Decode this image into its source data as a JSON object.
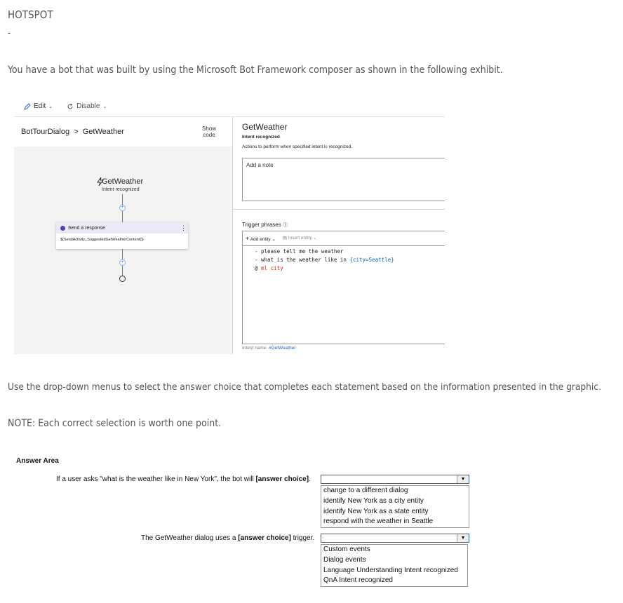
{
  "question": {
    "title": "HOTSPOT",
    "dash": "-",
    "intro": "You have a bot that was built by using the Microsoft Bot Framework composer as shown in the following exhibit.",
    "instruction": "Use the drop-down menus to select the answer choice that completes each statement based on the information presented in the graphic.",
    "note": "NOTE: Each correct selection is worth one point."
  },
  "exhibit": {
    "toolbar": {
      "edit": "Edit",
      "disable": "Disable"
    },
    "breadcrumb": "BotTourDialog  >  GetWeather",
    "show_code": [
      "Show",
      "code"
    ],
    "flow": {
      "trigger_title": "GetWeather",
      "trigger_sub": "Intent recognized",
      "card_title": "Send a response",
      "card_body": "${SendActivity_SuggestedGetWeatherContent()}"
    },
    "panel": {
      "title": "GetWeather",
      "subtitle": "Intent recognized",
      "description": "Actions to perform when specified intent is recognized.",
      "note_placeholder": "Add a note",
      "trigger_label": "Trigger phrases",
      "add_entity": "Add entity",
      "insert_entity": "Insert entity",
      "code_lines": [
        "- please tell me the weather",
        "- what is the weather like in ",
        "{city=Seattle}",
        "@ ",
        "ml",
        " city"
      ],
      "intent_label": "Intent name: ",
      "intent_value": "#GetWeather"
    }
  },
  "answer_area": {
    "title": "Answer Area",
    "q1": {
      "prefix": "If a user asks \"what is the weather like in New York\", the bot will ",
      "blank": "[answer choice]",
      "suffix": ".",
      "options": [
        "change to a different dialog",
        "identify New York as a city entity",
        "identify New York as a state entity",
        "respond with the weather in Seattle"
      ]
    },
    "q2": {
      "prefix": "The GetWeather dialog uses a ",
      "blank": "[answer choice]",
      "suffix": " trigger.",
      "options": [
        "Custom events",
        "Dialog events",
        "Language Understanding Intent recognized",
        "QnA Intent recognized"
      ]
    }
  }
}
